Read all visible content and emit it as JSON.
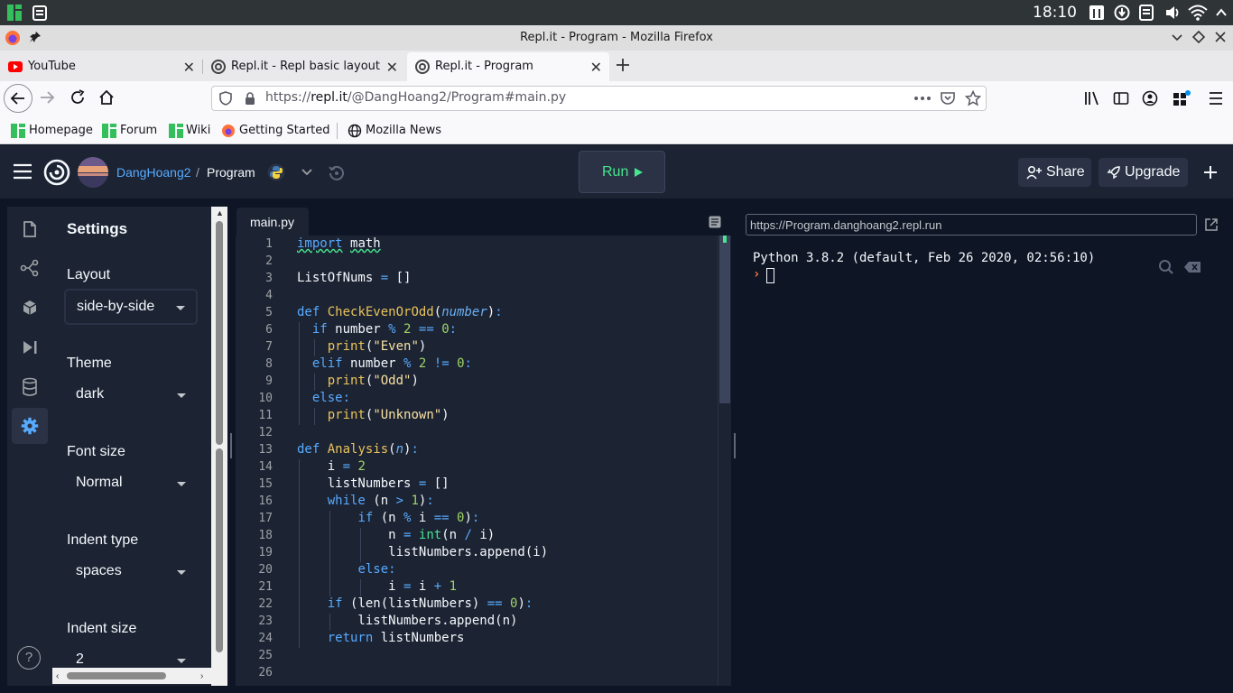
{
  "system": {
    "clock": "18:10"
  },
  "window": {
    "title": "Repl.it - Program - Mozilla Firefox"
  },
  "tabs": [
    {
      "label": "YouTube",
      "icon": "youtube-icon",
      "active": false
    },
    {
      "label": "Repl.it - Repl basic layout",
      "icon": "replit-icon",
      "active": false
    },
    {
      "label": "Repl.it - Program",
      "icon": "replit-icon",
      "active": true
    }
  ],
  "nav": {
    "url_prefix": "https://",
    "url_host": "repl.it",
    "url_path": "/@DangHoang2/Program#main.py"
  },
  "bookmarks": [
    "Homepage",
    "Forum",
    "Wiki",
    "Getting Started",
    "Mozilla News"
  ],
  "repl": {
    "user": "DangHoang2",
    "separator": "/",
    "project": "Program",
    "run_label": "Run",
    "share_label": "Share",
    "upgrade_label": "Upgrade"
  },
  "settings": {
    "title": "Settings",
    "items": [
      {
        "label": "Layout",
        "value": "side-by-side"
      },
      {
        "label": "Theme",
        "value": "dark"
      },
      {
        "label": "Font size",
        "value": "Normal"
      },
      {
        "label": "Indent type",
        "value": "spaces"
      },
      {
        "label": "Indent size",
        "value": "2"
      }
    ]
  },
  "editor": {
    "filename": "main.py",
    "line_numbers": [
      "1",
      "2",
      "3",
      "4",
      "5",
      "6",
      "7",
      "8",
      "9",
      "10",
      "11",
      "12",
      "13",
      "14",
      "15",
      "16",
      "17",
      "18",
      "19",
      "20",
      "21",
      "22",
      "23",
      "24",
      "25",
      "26"
    ]
  },
  "console": {
    "url": "https://Program.danghoang2.repl.run",
    "output": "Python 3.8.2 (default, Feb 26 2020, 02:56:10)",
    "prompt": "›"
  },
  "help": "?",
  "colors": {
    "accent": "#0079f2",
    "run_green": "#47e58f",
    "bg": "#0e1525",
    "panel": "#1c2333"
  }
}
